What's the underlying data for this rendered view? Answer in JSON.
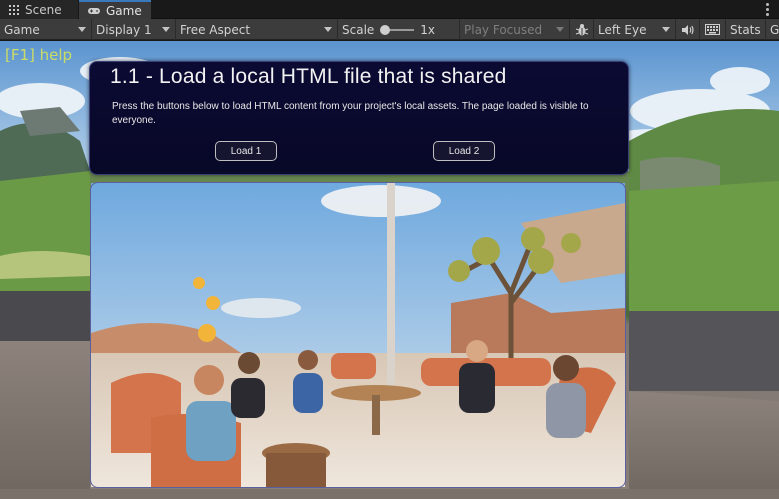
{
  "tabs": [
    {
      "label": "Scene",
      "icon": "grid-icon"
    },
    {
      "label": "Game",
      "icon": "gamepad-icon"
    }
  ],
  "toolbar": {
    "game_view": "Game",
    "display": "Display 1",
    "aspect": "Free Aspect",
    "scale_label": "Scale",
    "scale_value": "1x",
    "play_mode": "Play Focused",
    "eye": "Left Eye",
    "stats_label": "Stats",
    "gizmos_label": "G"
  },
  "viewport": {
    "help_hint": "[F1] help",
    "panel": {
      "title": "1.1 - Load a local HTML file that is shared",
      "description": "Press the buttons below to load HTML content from your project's local assets. The page loaded is visible to everyone.",
      "buttons": [
        "Load 1",
        "Load 2"
      ]
    }
  },
  "colors": {
    "panel_bg": "#0b0a33",
    "help_text": "#d6e35a",
    "tab_active_accent": "#3a79bb"
  }
}
